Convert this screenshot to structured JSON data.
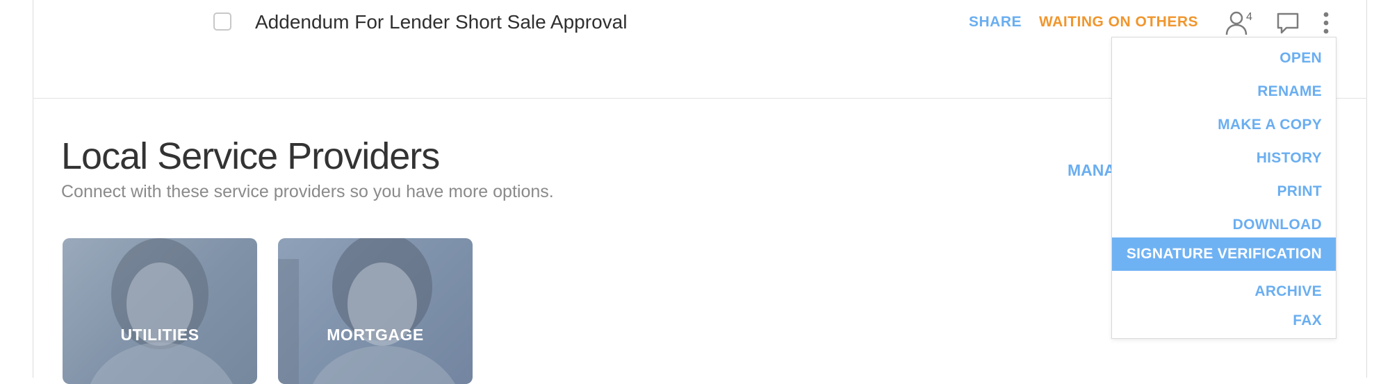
{
  "document_row": {
    "title": "Addendum For Lender Short Sale Approval",
    "share_label": "SHARE",
    "status_label": "WAITING ON OTHERS",
    "participants_count": "4",
    "colors": {
      "share": "#6aaef0",
      "status": "#f0962e"
    },
    "icons": [
      "checkbox",
      "person-icon",
      "comment-icon",
      "more-vertical-icon"
    ]
  },
  "section": {
    "title": "Local Service Providers",
    "subtitle": "Connect with these service providers so you have more options.",
    "manage_label": "MANA"
  },
  "cards": [
    {
      "label": "UTILITIES"
    },
    {
      "label": "MORTGAGE"
    }
  ],
  "context_menu": {
    "items": [
      {
        "label": "OPEN"
      },
      {
        "label": "RENAME"
      },
      {
        "label": "MAKE A COPY"
      },
      {
        "label": "HISTORY"
      },
      {
        "label": "PRINT"
      },
      {
        "label": "DOWNLOAD"
      },
      {
        "label": "SIGNATURE VERIFICATION"
      },
      {
        "label": "ARCHIVE"
      },
      {
        "label": "FAX"
      }
    ],
    "highlighted": "SIGNATURE VERIFICATION",
    "colors": {
      "item": "#6aaef0",
      "highlight_bg": "#6fb2f3"
    }
  }
}
